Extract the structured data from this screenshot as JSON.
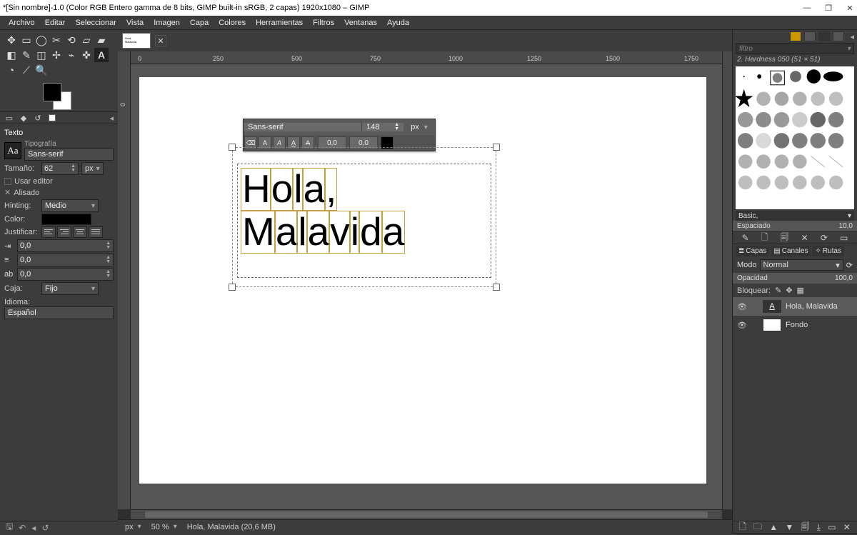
{
  "window": {
    "title": "*[Sin nombre]-1.0 (Color RGB Entero gamma de 8 bits, GIMP built-in sRGB, 2 capas) 1920x1080 – GIMP",
    "minimize": "—",
    "maximize": "❐",
    "close": "✕"
  },
  "menu": {
    "items": [
      "Archivo",
      "Editar",
      "Seleccionar",
      "Vista",
      "Imagen",
      "Capa",
      "Colores",
      "Herramientas",
      "Filtros",
      "Ventanas",
      "Ayuda"
    ]
  },
  "ruler": {
    "marks_h": [
      "0",
      "250",
      "500",
      "750",
      "1000",
      "1250",
      "1500",
      "1750"
    ],
    "mark_v": "0"
  },
  "text_options": {
    "title": "Texto",
    "typography_label": "Tipografía",
    "font_name": "Sans-serif",
    "size_label": "Tamaño:",
    "size_value": "62",
    "unit": "px",
    "use_editor": "Usar editor",
    "antialias": "Alisado",
    "hinting_label": "Hinting:",
    "hinting_value": "Medio",
    "color_label": "Color:",
    "justify_label": "Justificar:",
    "indent_value": "0,0",
    "line_value": "0,0",
    "letter_value": "0,0",
    "box_label": "Caja:",
    "box_value": "Fijo",
    "lang_label": "Idioma:",
    "lang_value": "Español"
  },
  "text_tool": {
    "font": "Sans-serif",
    "size": "148",
    "unit": "px",
    "num1": "0,0",
    "num2": "0,0"
  },
  "canvas_text": {
    "line1": "Hola,",
    "line2": "Malavida"
  },
  "status": {
    "unit": "px",
    "zoom": "50 %",
    "info": "Hola, Malavida (20,6 MB)"
  },
  "right": {
    "filter_placeholder": "filtro",
    "brush_info": "2. Hardness 050 (51 × 51)",
    "brush_preset": "Basic,",
    "spacing_label": "Espaciado",
    "spacing_value": "10,0",
    "tabs": {
      "layers": "Capas",
      "channels": "Canales",
      "paths": "Rutas"
    },
    "mode_label": "Modo",
    "mode_value": "Normal",
    "opacity_label": "Opacidad",
    "opacity_value": "100,0",
    "lock_label": "Bloquear:",
    "layers": [
      {
        "name": "Hola, Malavida",
        "type": "text"
      },
      {
        "name": "Fondo",
        "type": "bg"
      }
    ]
  }
}
